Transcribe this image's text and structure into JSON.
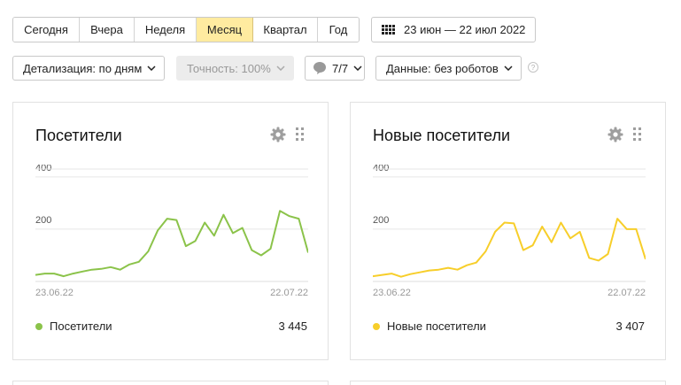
{
  "period_tabs": [
    "Сегодня",
    "Вчера",
    "Неделя",
    "Месяц",
    "Квартал",
    "Год"
  ],
  "active_period": "Месяц",
  "date_range": "23 июн — 22 июл 2022",
  "controls": {
    "detail": "Детализация: по дням",
    "accuracy": "Точность: 100%",
    "segments": "7/7",
    "data": "Данные: без роботов",
    "help": "?"
  },
  "cards": [
    {
      "title": "Посетители",
      "legend_label": "Посетители",
      "total": "3 445",
      "color": "#8bc34a",
      "chart_data": {
        "type": "line",
        "x": [
          "23.06.22",
          "24.06.22",
          "25.06.22",
          "26.06.22",
          "27.06.22",
          "28.06.22",
          "29.06.22",
          "30.06.22",
          "01.07.22",
          "02.07.22",
          "03.07.22",
          "04.07.22",
          "05.07.22",
          "06.07.22",
          "07.07.22",
          "08.07.22",
          "09.07.22",
          "10.07.22",
          "11.07.22",
          "12.07.22",
          "13.07.22",
          "14.07.22",
          "15.07.22",
          "16.07.22",
          "17.07.22",
          "18.07.22",
          "19.07.22",
          "20.07.22",
          "21.07.22",
          "22.07.22"
        ],
        "values": [
          25,
          30,
          30,
          20,
          30,
          38,
          45,
          48,
          55,
          45,
          65,
          75,
          115,
          195,
          240,
          235,
          135,
          155,
          225,
          175,
          255,
          185,
          205,
          120,
          100,
          125,
          270,
          250,
          240,
          110
        ],
        "ylim": [
          0,
          430
        ],
        "y_ticks": [
          "200",
          "400"
        ],
        "x_tick_labels": [
          "23.06.22",
          "22.07.22"
        ]
      }
    },
    {
      "title": "Новые посетители",
      "legend_label": "Новые посетители",
      "total": "3 407",
      "color": "#f7ce2a",
      "chart_data": {
        "type": "line",
        "x": [
          "23.06.22",
          "24.06.22",
          "25.06.22",
          "26.06.22",
          "27.06.22",
          "28.06.22",
          "29.06.22",
          "30.06.22",
          "01.07.22",
          "02.07.22",
          "03.07.22",
          "04.07.22",
          "05.07.22",
          "06.07.22",
          "07.07.22",
          "08.07.22",
          "09.07.22",
          "10.07.22",
          "11.07.22",
          "12.07.22",
          "13.07.22",
          "14.07.22",
          "15.07.22",
          "16.07.22",
          "17.07.22",
          "18.07.22",
          "19.07.22",
          "20.07.22",
          "21.07.22",
          "22.07.22"
        ],
        "values": [
          20,
          25,
          30,
          18,
          28,
          35,
          42,
          45,
          52,
          45,
          62,
          72,
          115,
          190,
          225,
          222,
          120,
          138,
          210,
          150,
          225,
          165,
          190,
          90,
          80,
          105,
          240,
          200,
          200,
          85
        ],
        "ylim": [
          0,
          430
        ],
        "y_ticks": [
          "200",
          "400"
        ],
        "x_tick_labels": [
          "23.06.22",
          "22.07.22"
        ]
      }
    }
  ]
}
